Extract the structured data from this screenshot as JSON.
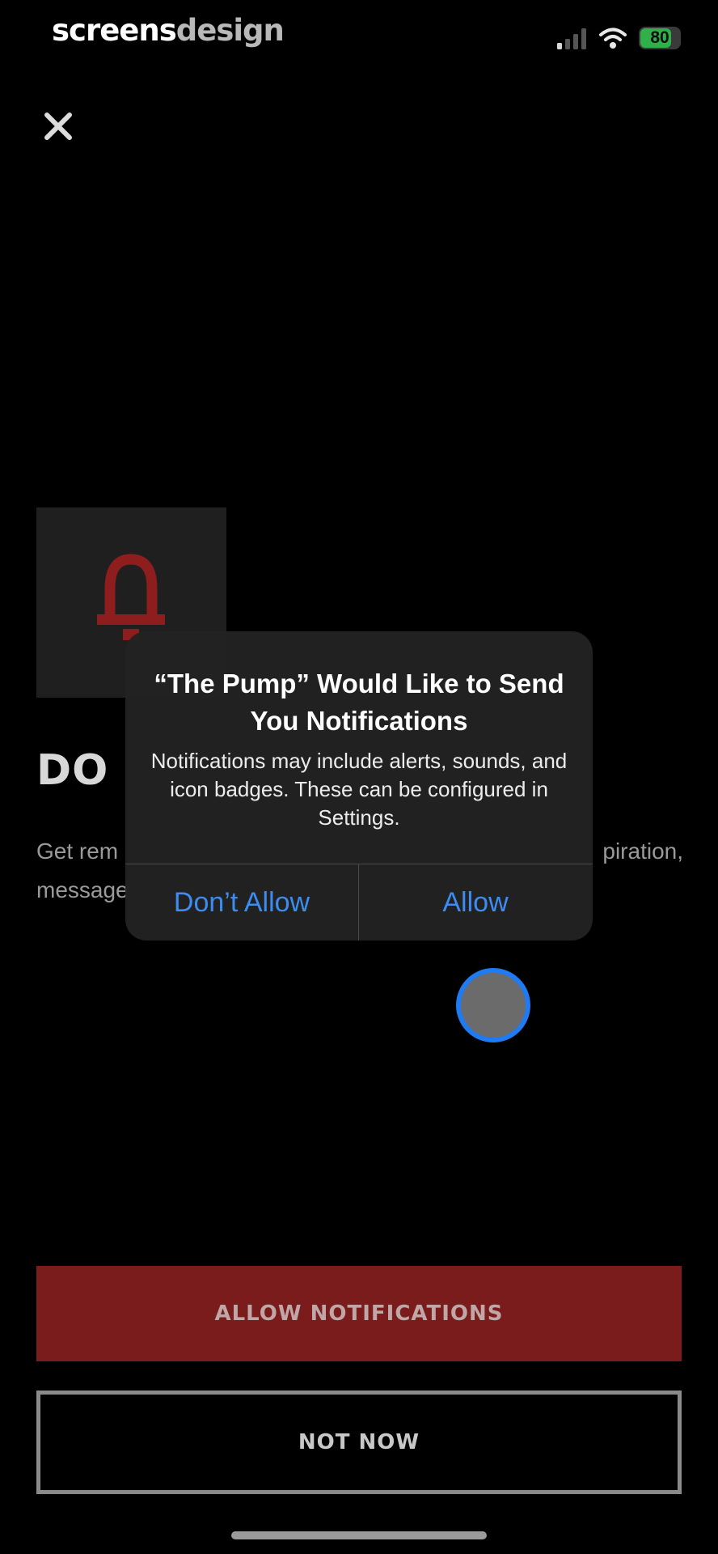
{
  "status_bar": {
    "watermark_part1": "screens",
    "watermark_part2": "design",
    "battery_percent": "80",
    "battery_level": 0.8,
    "battery_color": "#2fb04a",
    "signal_icon": "cellular-signal-icon",
    "wifi_icon": "wifi-icon"
  },
  "close_icon": "close-icon",
  "background_screen": {
    "bell_icon": "bell-icon",
    "headline_visible": "DO",
    "body_left_line1": "Get rem",
    "body_left_line2": "message",
    "body_right_line1": "piration,",
    "accent_color": "#7a1c1c",
    "allow_button_label": "ALLOW NOTIFICATIONS",
    "not_now_button_label": "NOT NOW"
  },
  "alert": {
    "title": "“The Pump” Would Like to Send You Notifications",
    "message": "Notifications may include alerts, sounds, and icon badges. These can be configured in Settings.",
    "dont_allow_label": "Don’t Allow",
    "allow_label": "Allow",
    "button_color": "#3d8cf0"
  }
}
